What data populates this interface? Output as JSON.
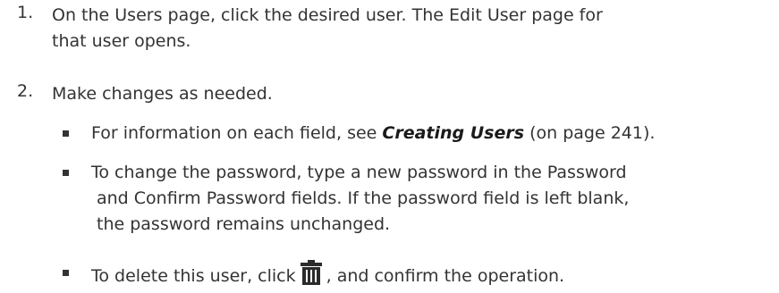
{
  "steps": [
    {
      "number": "1.",
      "line1": "On the Users page, click the desired user. The Edit User page for",
      "line2": "that user opens."
    },
    {
      "number": "2.",
      "text": "Make changes as needed."
    }
  ],
  "bullets": {
    "info": {
      "before": "For information on each field, see ",
      "link": "Creating Users",
      "after": " (on page 241)."
    },
    "password": {
      "line1": "To change the password, type a new password in the Password",
      "line2": "and Confirm Password fields. If the password field is left blank,",
      "line3": "the password remains unchanged."
    },
    "delete": {
      "before": "To delete this user, click",
      "icon": "trash-icon",
      "after": ", and confirm the operation."
    }
  }
}
